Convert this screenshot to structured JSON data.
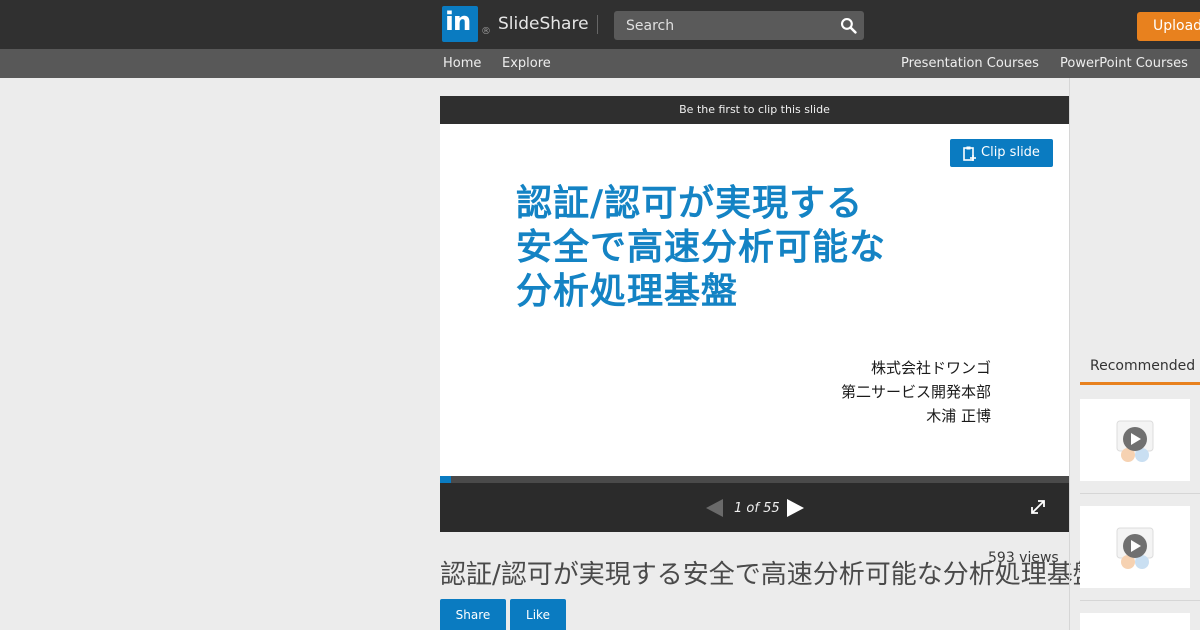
{
  "header": {
    "logo_text": "in",
    "logo_reg": "®",
    "brand": "SlideShare",
    "search_placeholder": "Search",
    "upload_label": "Upload"
  },
  "subnav": {
    "home": "Home",
    "explore": "Explore",
    "presentation_courses": "Presentation Courses",
    "powerpoint_courses": "PowerPoint Courses"
  },
  "player": {
    "clip_banner": "Be the first to clip this slide",
    "clip_button": "Clip slide",
    "slide_title_lines": [
      "認証/認可が実現する",
      "安全で高速分析可能な",
      "分析処理基盤"
    ],
    "slide_author_lines": [
      "株式会社ドワンゴ",
      "第二サービス開発本部",
      "木浦 正博"
    ],
    "page_indicator": "1 of 55",
    "progress_fraction": 0.018
  },
  "details": {
    "title": "認証/認可が実現する安全で高速分析可能な分析処理基盤",
    "views": "593 views",
    "share_label": "Share",
    "like_label": "Like"
  },
  "sidebar": {
    "recommended_heading": "Recommended"
  },
  "colors": {
    "brand_blue": "#0a7bc1",
    "upload_orange": "#e8811e",
    "slide_title_blue": "#1483c4"
  }
}
